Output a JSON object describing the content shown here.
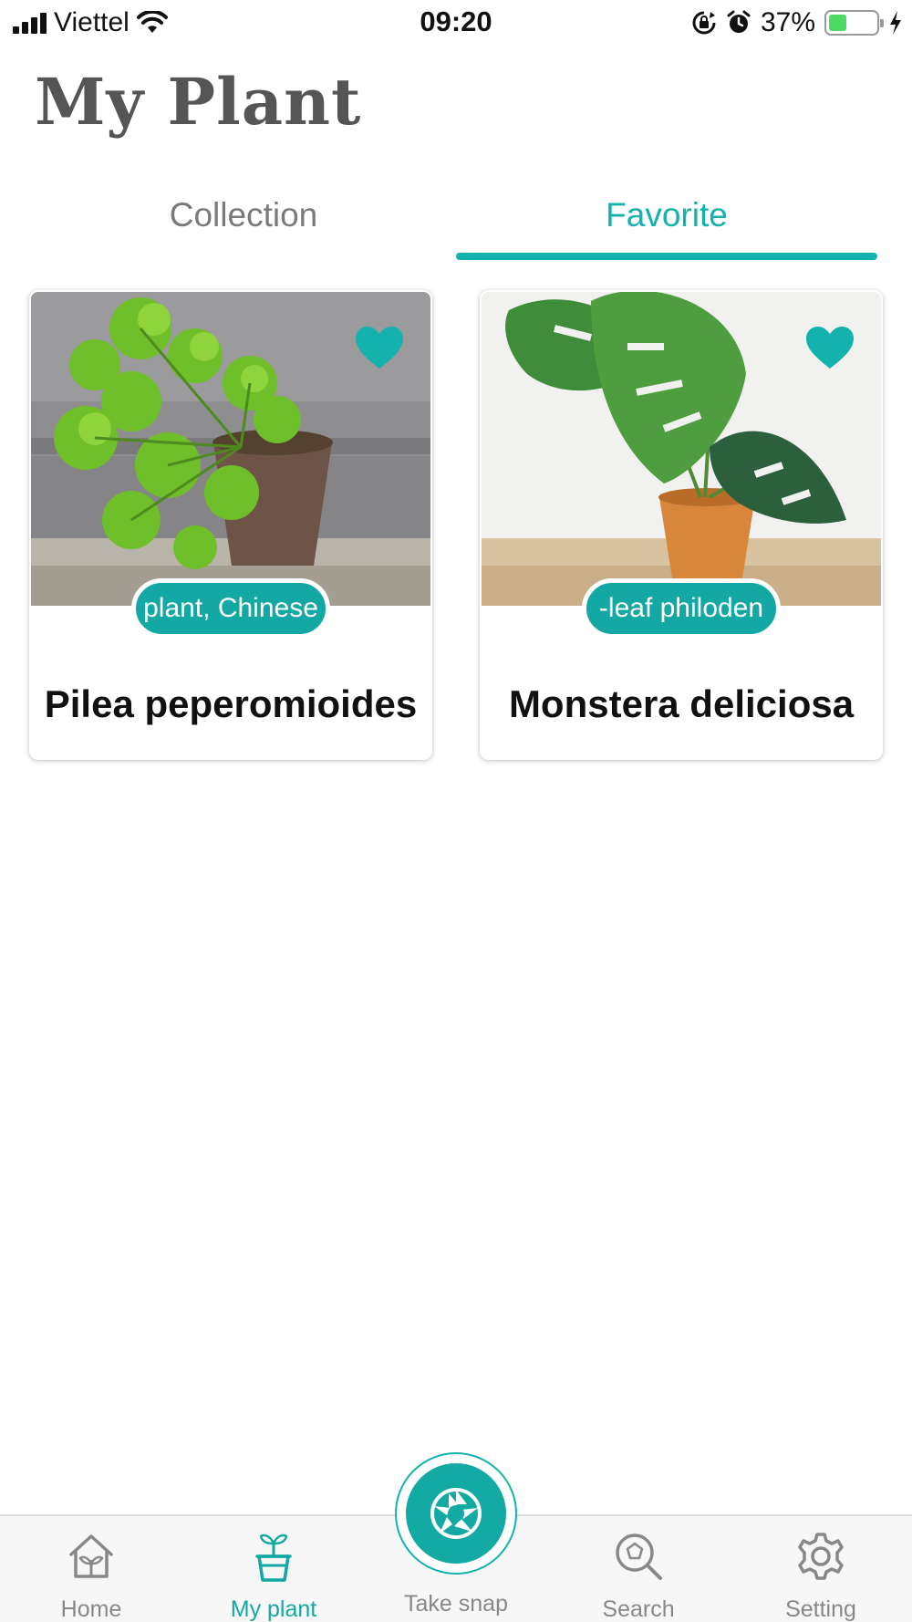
{
  "status_bar": {
    "carrier": "Viettel",
    "time": "09:20",
    "battery_percent": "37%",
    "battery_level": 0.37
  },
  "page": {
    "title": "My Plant"
  },
  "tabs": [
    {
      "label": "Collection",
      "active": false
    },
    {
      "label": "Favorite",
      "active": true
    }
  ],
  "plants": [
    {
      "common_name": "plant, Chinese",
      "scientific_name": "Pilea peperomioides",
      "favorite": true
    },
    {
      "common_name": "-leaf philoden",
      "scientific_name": "Monstera deliciosa",
      "favorite": true
    }
  ],
  "nav": [
    {
      "label": "Home",
      "icon": "house-plant-icon",
      "active": false
    },
    {
      "label": "My plant",
      "icon": "potted-sprout-icon",
      "active": true
    },
    {
      "label": "Take snap",
      "icon": "camera-aperture-icon",
      "active": false
    },
    {
      "label": "Search",
      "icon": "search-icon",
      "active": false
    },
    {
      "label": "Setting",
      "icon": "gear-icon",
      "active": false
    }
  ],
  "colors": {
    "accent": "#13b2ad",
    "title": "#555555",
    "inactive": "#888888"
  }
}
